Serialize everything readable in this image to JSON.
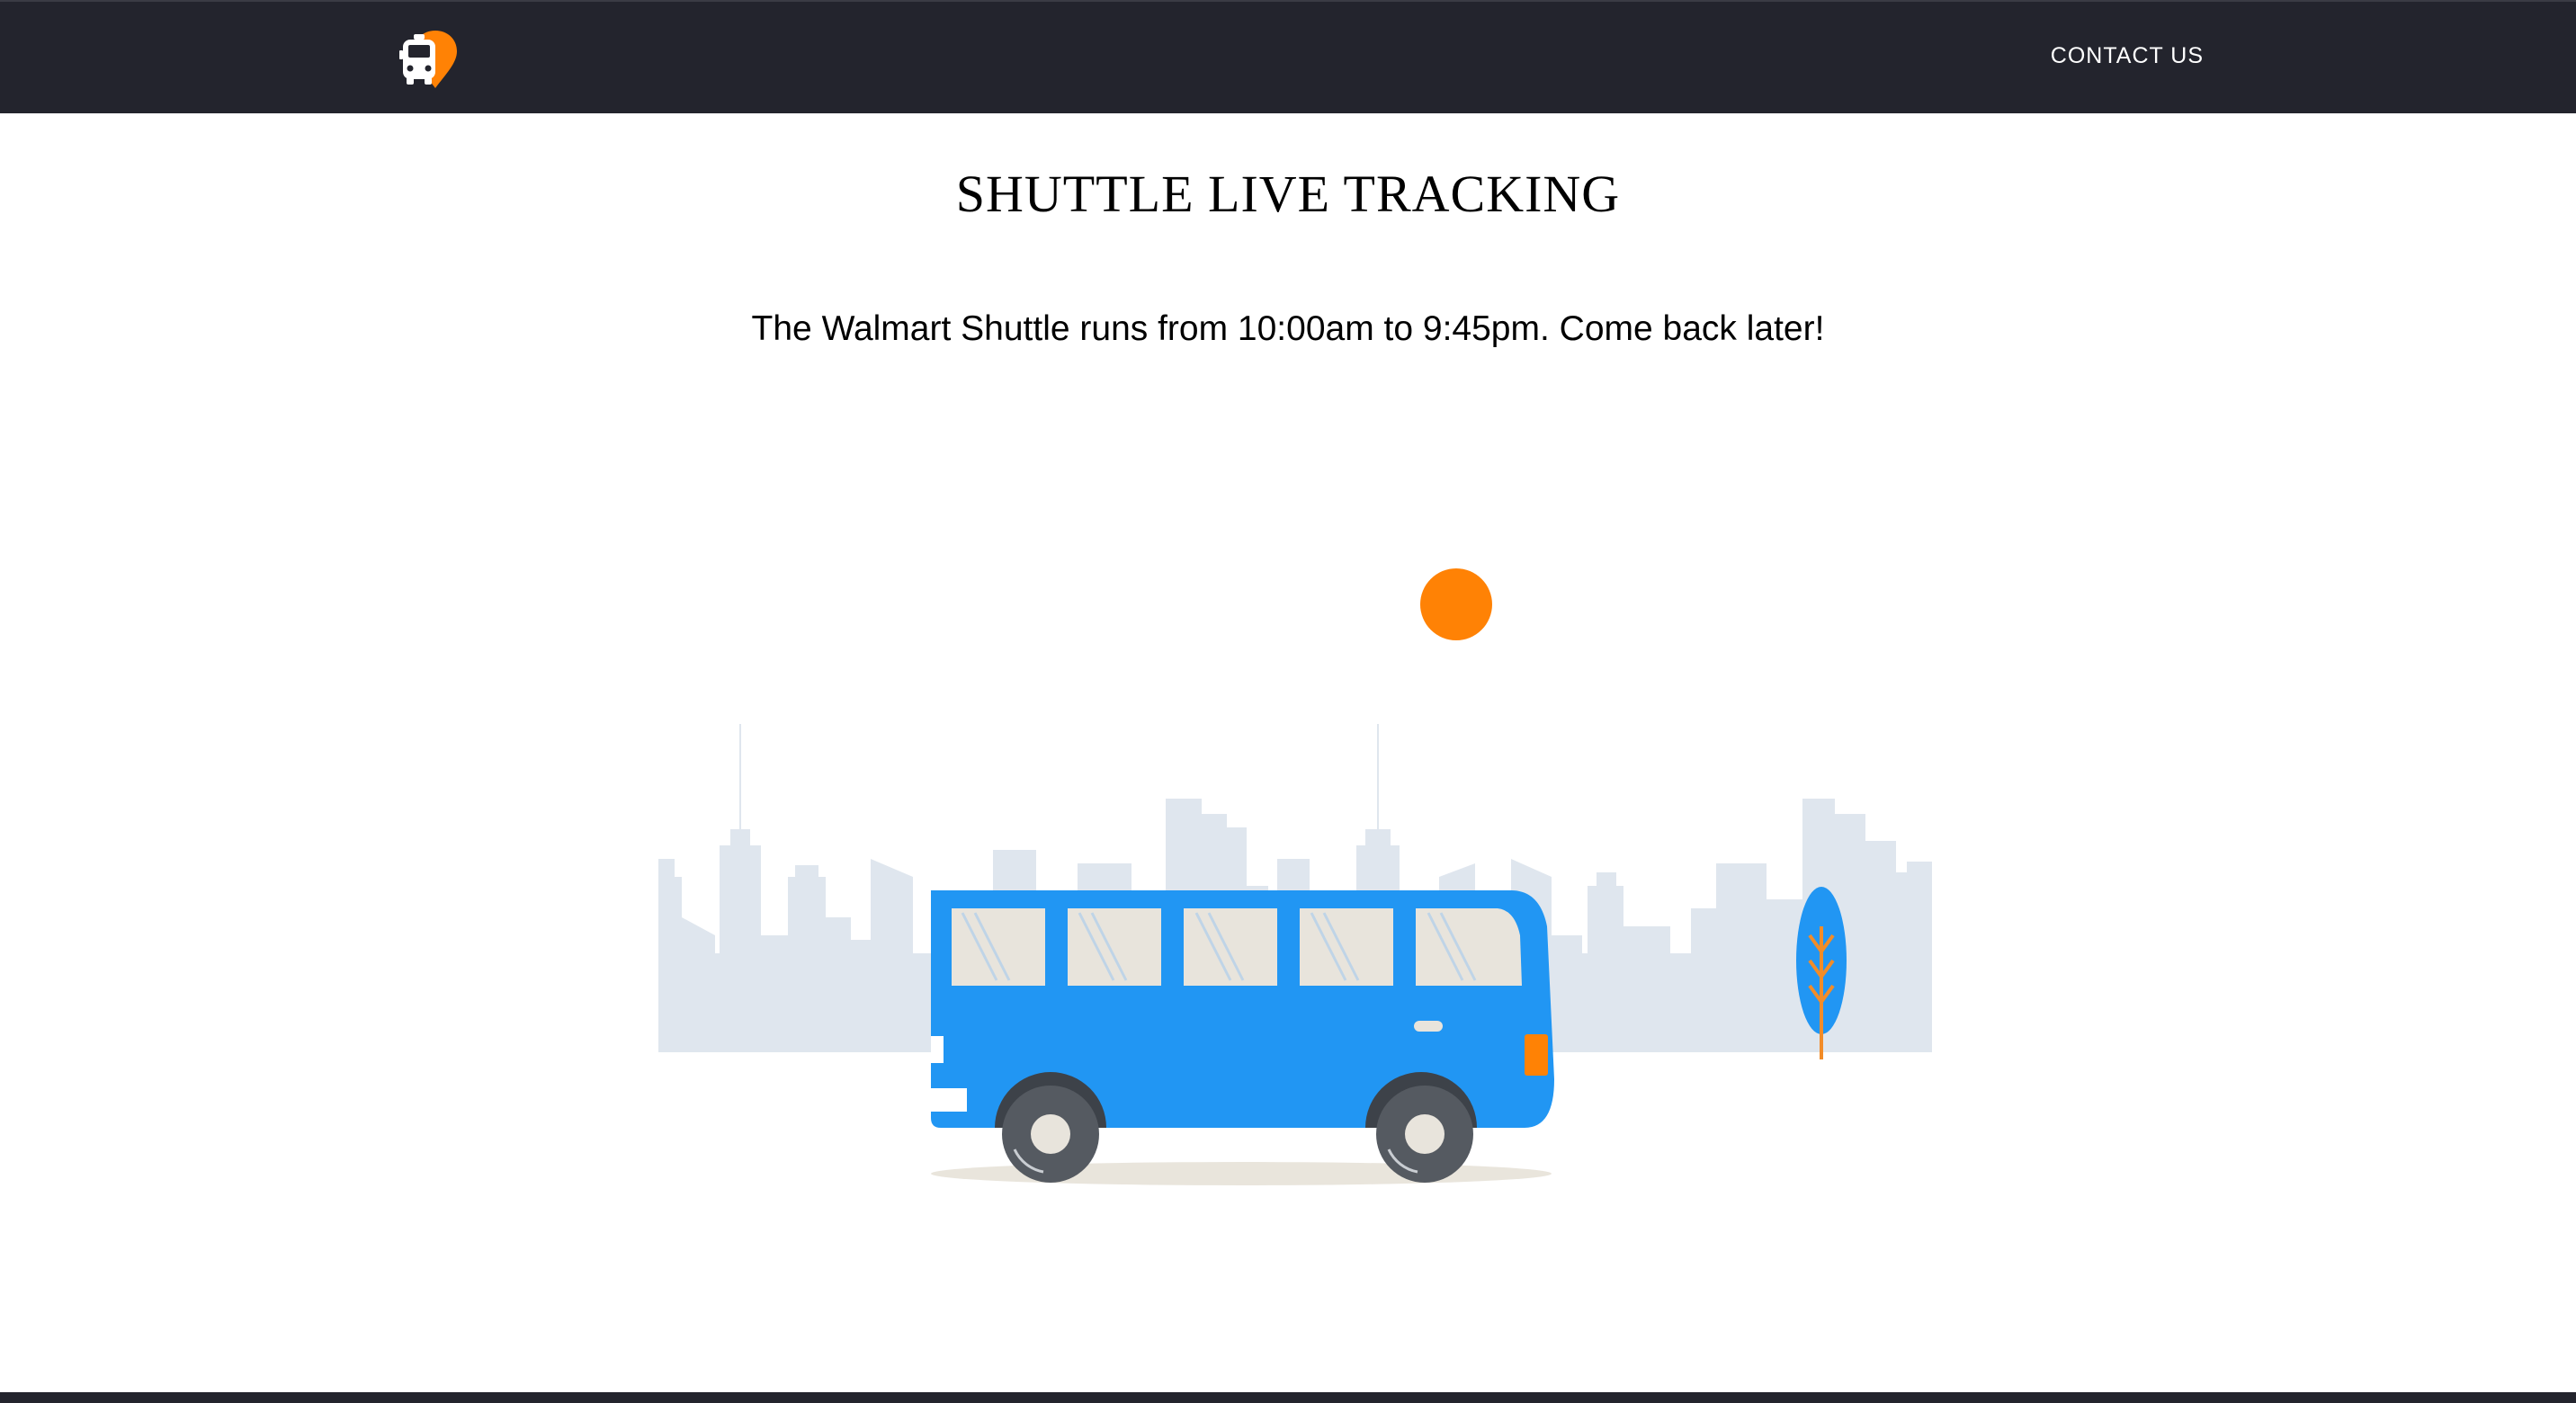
{
  "header": {
    "logo_icon": "shuttle-location-icon",
    "contact_label": "CONTACT US"
  },
  "main": {
    "title": "SHUTTLE LIVE TRACKING",
    "message": "The Walmart Shuttle runs from 10:00am to 9:45pm. Come back later!"
  },
  "colors": {
    "navbar": "#23242d",
    "bus_body": "#2196f3",
    "sun": "#ff8205",
    "skyline": "#dfe6ee",
    "tree": "#2196f3",
    "tree_branch": "#f28c28",
    "wheel": "#555a61",
    "window": "#e8e4dc"
  }
}
